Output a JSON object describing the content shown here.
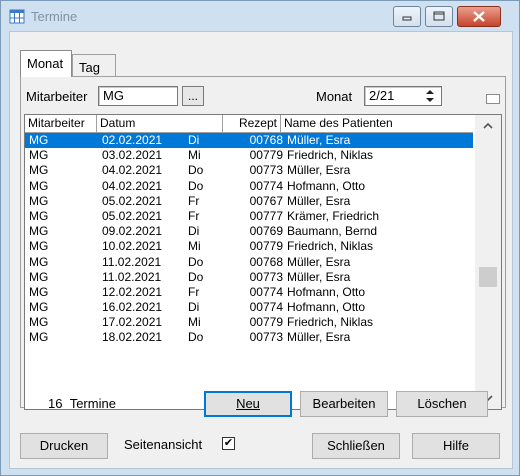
{
  "window": {
    "title": "Termine"
  },
  "tabs": [
    {
      "label": "Monat"
    },
    {
      "label": "Tag"
    }
  ],
  "filter": {
    "mitarbeiter_label": "Mitarbeiter",
    "mitarbeiter_value": "MG",
    "browse_label": "...",
    "monat_label": "Monat",
    "monat_value": "2/21"
  },
  "list": {
    "headers": {
      "mitarbeiter": "Mitarbeiter",
      "datum": "Datum",
      "rezept": "Rezept",
      "name": "Name des Patienten"
    },
    "selected_index": 0,
    "rows": [
      {
        "mitarbeiter": "MG",
        "datum": "02.02.2021",
        "tag": "Di",
        "rezept": "00768",
        "name": "Müller, Esra"
      },
      {
        "mitarbeiter": "MG",
        "datum": "03.02.2021",
        "tag": "Mi",
        "rezept": "00779",
        "name": "Friedrich, Niklas"
      },
      {
        "mitarbeiter": "MG",
        "datum": "04.02.2021",
        "tag": "Do",
        "rezept": "00773",
        "name": "Müller, Esra"
      },
      {
        "mitarbeiter": "MG",
        "datum": "04.02.2021",
        "tag": "Do",
        "rezept": "00774",
        "name": "Hofmann, Otto"
      },
      {
        "mitarbeiter": "MG",
        "datum": "05.02.2021",
        "tag": "Fr",
        "rezept": "00767",
        "name": "Müller, Esra"
      },
      {
        "mitarbeiter": "MG",
        "datum": "05.02.2021",
        "tag": "Fr",
        "rezept": "00777",
        "name": "Krämer, Friedrich"
      },
      {
        "mitarbeiter": "MG",
        "datum": "09.02.2021",
        "tag": "Di",
        "rezept": "00769",
        "name": "Baumann, Bernd"
      },
      {
        "mitarbeiter": "MG",
        "datum": "10.02.2021",
        "tag": "Mi",
        "rezept": "00779",
        "name": "Friedrich, Niklas"
      },
      {
        "mitarbeiter": "MG",
        "datum": "11.02.2021",
        "tag": "Do",
        "rezept": "00768",
        "name": "Müller, Esra"
      },
      {
        "mitarbeiter": "MG",
        "datum": "11.02.2021",
        "tag": "Do",
        "rezept": "00773",
        "name": "Müller, Esra"
      },
      {
        "mitarbeiter": "MG",
        "datum": "12.02.2021",
        "tag": "Fr",
        "rezept": "00774",
        "name": "Hofmann, Otto"
      },
      {
        "mitarbeiter": "MG",
        "datum": "16.02.2021",
        "tag": "Di",
        "rezept": "00774",
        "name": "Hofmann, Otto"
      },
      {
        "mitarbeiter": "MG",
        "datum": "17.02.2021",
        "tag": "Mi",
        "rezept": "00779",
        "name": "Friedrich, Niklas"
      },
      {
        "mitarbeiter": "MG",
        "datum": "18.02.2021",
        "tag": "Do",
        "rezept": "00773",
        "name": "Müller, Esra"
      }
    ]
  },
  "summary": {
    "count": "16",
    "count_label": "Termine"
  },
  "buttons": {
    "neu": "Neu",
    "bearbeiten": "Bearbeiten",
    "loeschen": "Löschen",
    "drucken": "Drucken",
    "seitenansicht": "Seitenansicht",
    "schliessen": "Schließen",
    "hilfe": "Hilfe"
  },
  "seitenansicht_checked": true,
  "colors": {
    "selection": "#0078d7",
    "default_button_border": "#0078d7",
    "close_button": "#c7442b"
  },
  "icons": [
    "calendar-icon",
    "minimize-icon",
    "maximize-icon",
    "close-icon",
    "spin-up-icon",
    "spin-down-icon",
    "scroll-up-icon",
    "scroll-down-icon",
    "checkmark-icon"
  ]
}
